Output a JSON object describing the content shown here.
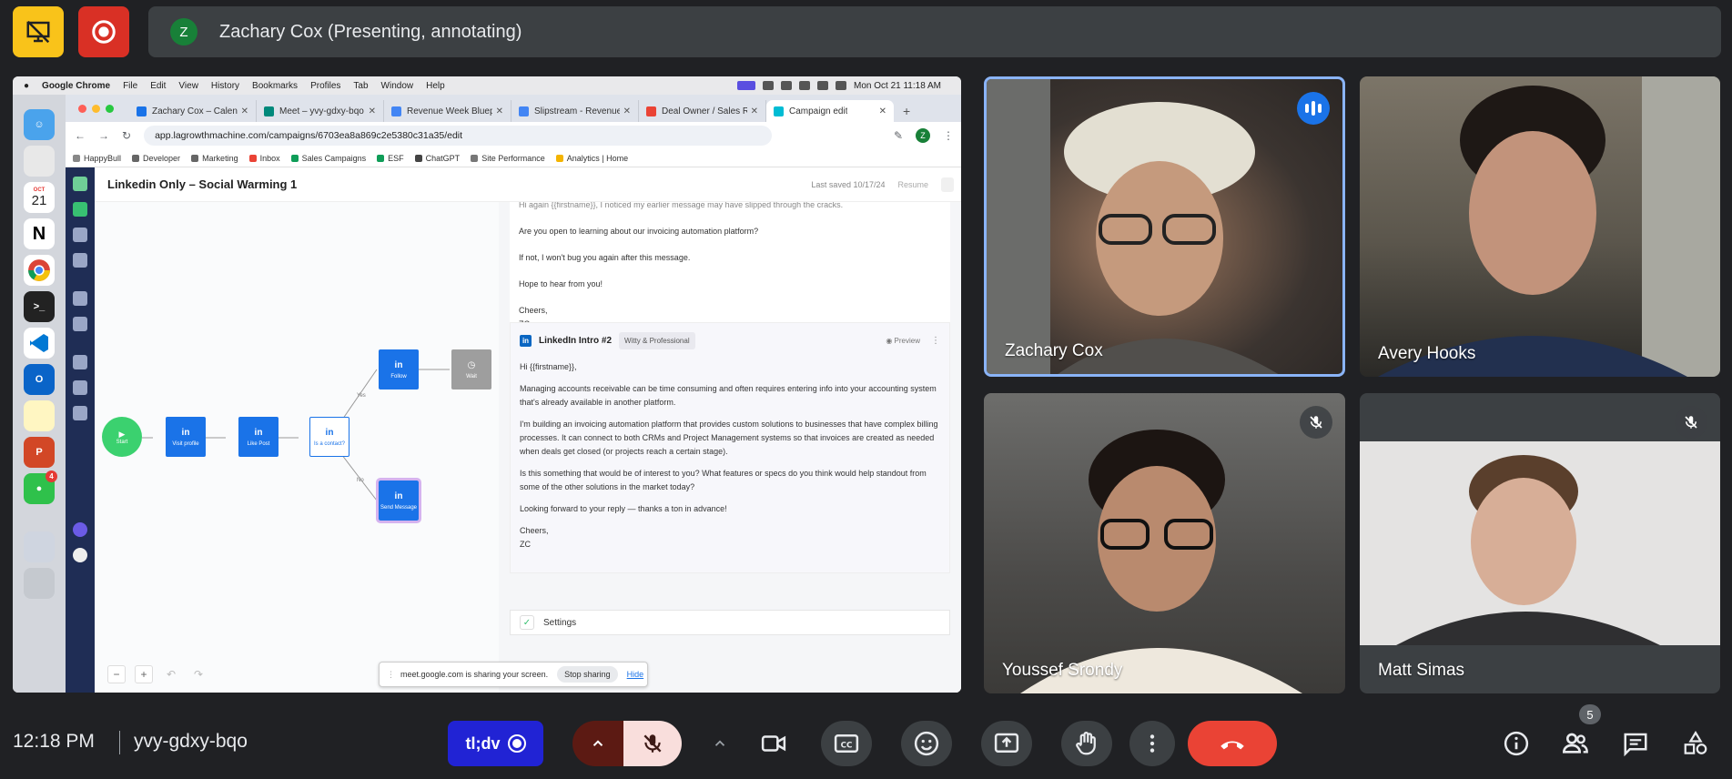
{
  "top_bar": {
    "presenter_initial": "Z",
    "presenter_text": "Zachary Cox (Presenting, annotating)"
  },
  "mac_menubar": {
    "app": "Google Chrome",
    "menus": [
      "File",
      "Edit",
      "View",
      "History",
      "Bookmarks",
      "Profiles",
      "Tab",
      "Window",
      "Help"
    ],
    "datetime": "Mon Oct 21  11:18 AM"
  },
  "dock": {
    "calendar_month": "OCT",
    "calendar_day": "21",
    "messages_badge": "4"
  },
  "browser": {
    "tabs": [
      {
        "label": "Zachary Cox – Calendar",
        "color": "#1a73e8"
      },
      {
        "label": "Meet – yvy-gdxy-bqo",
        "color": "#00897b"
      },
      {
        "label": "Revenue Week Blueprint",
        "color": "#4285f4"
      },
      {
        "label": "Slipstream - Revenue W",
        "color": "#4285f4"
      },
      {
        "label": "Deal Owner / Sales Rep",
        "color": "#ea4335"
      },
      {
        "label": "Campaign edit",
        "color": "#00bcd4"
      }
    ],
    "url": "app.lagrowthmachine.com/campaigns/6703ea8a869c2e5380c31a35/edit",
    "profile_initial": "Z",
    "bookmarks": [
      {
        "label": "HappyBull",
        "color": "#888"
      },
      {
        "label": "Developer",
        "color": "#666"
      },
      {
        "label": "Marketing",
        "color": "#666"
      },
      {
        "label": "Inbox",
        "color": "#ea4335"
      },
      {
        "label": "Sales Campaigns",
        "color": "#0f9d58"
      },
      {
        "label": "ESF",
        "color": "#0f9d58"
      },
      {
        "label": "ChatGPT",
        "color": "#444"
      },
      {
        "label": "Site Performance",
        "color": "#777"
      },
      {
        "label": "Analytics | Home",
        "color": "#f4b400"
      }
    ]
  },
  "app": {
    "campaign_title": "Linkedin Only – Social Warming 1",
    "last_saved": "Last saved 10/17/24",
    "resume": "Resume",
    "nodes": {
      "start": "Start",
      "visit": "Visit profile",
      "like": "Like Post",
      "connected": "Is a contact?",
      "follow": "Follow",
      "wait": "Wait",
      "send": "Send Message",
      "yes": "Yes",
      "no": "No"
    },
    "top_messages": [
      "Hi again {{firstname}}, I noticed my earlier message may have slipped through the cracks.",
      "Are you open to learning about our invoicing automation platform?",
      "If not, I won't bug you again after this message.",
      "Hope to hear from you!",
      "Cheers,",
      "ZC"
    ],
    "card": {
      "title": "LinkedIn Intro #2",
      "tone": "Witty & Professional",
      "preview": "Preview",
      "lines": [
        "Hi {{firstname}},",
        "Managing accounts receivable can be time consuming and often requires entering info into your accounting system that's already available in another platform.",
        "I'm building an invoicing automation platform that provides custom solutions to businesses that have complex billing processes. It can connect to both CRMs and Project Management systems so that invoices are created as needed when deals get closed (or projects reach a certain stage).",
        "Is this something that would be of interest to you? What features or specs do you think would help standout from some of the other solutions in the market today?",
        "Looking forward to your reply — thanks a ton in advance!",
        "Cheers,",
        "ZC"
      ]
    },
    "settings": "Settings"
  },
  "share_banner": {
    "text": "meet.google.com is sharing your screen.",
    "stop": "Stop sharing",
    "hide": "Hide"
  },
  "participants": [
    {
      "name": "Zachary Cox",
      "state": "speaking"
    },
    {
      "name": "Avery Hooks",
      "state": "unmuted"
    },
    {
      "name": "Youssef Srondy",
      "state": "muted"
    },
    {
      "name": "Matt Simas",
      "state": "muted"
    }
  ],
  "bottom_bar": {
    "time": "12:18 PM",
    "meeting_code": "yvy-gdxy-bqo",
    "tldv_label": "tl;dv",
    "participant_count": "5"
  },
  "colors": {
    "meet_bg": "#202124",
    "end_call": "#ea4335",
    "mic_off_bg": "#f9dedc",
    "tldv": "#2123d4",
    "active_speaker_border": "#8ab4f8"
  }
}
